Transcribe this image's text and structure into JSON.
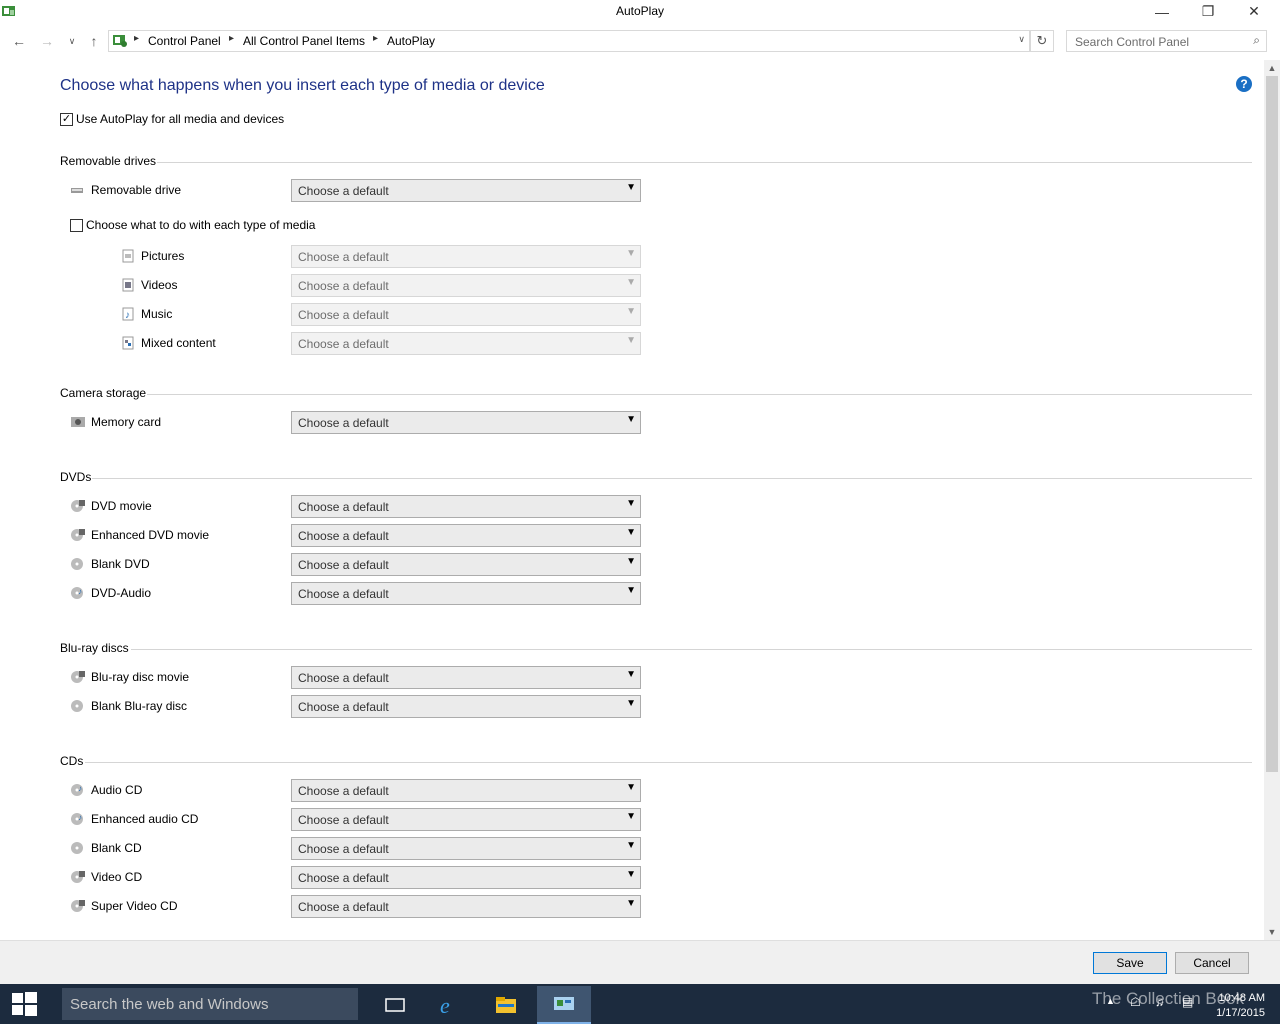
{
  "window": {
    "title": "AutoPlay"
  },
  "breadcrumb": [
    "Control Panel",
    "All Control Panel Items",
    "AutoPlay"
  ],
  "search": {
    "placeholder": "Search Control Panel"
  },
  "main": {
    "heading": "Choose what happens when you insert each type of media or device",
    "use_autoplay": {
      "label": "Use AutoPlay for all media and devices",
      "checked": true
    },
    "media_choice": {
      "label": "Choose what to do with each type of media",
      "checked": false
    },
    "default_option": "Choose a default",
    "sections": {
      "removable": {
        "title": "Removable drives",
        "items": [
          "Removable drive"
        ]
      },
      "media": {
        "items": [
          "Pictures",
          "Videos",
          "Music",
          "Mixed content"
        ]
      },
      "camera": {
        "title": "Camera storage",
        "items": [
          "Memory card"
        ]
      },
      "dvds": {
        "title": "DVDs",
        "items": [
          "DVD movie",
          "Enhanced DVD movie",
          "Blank DVD",
          "DVD-Audio"
        ]
      },
      "bluray": {
        "title": "Blu-ray discs",
        "items": [
          "Blu-ray disc movie",
          "Blank Blu-ray disc"
        ]
      },
      "cds": {
        "title": "CDs",
        "items": [
          "Audio CD",
          "Enhanced audio CD",
          "Blank CD",
          "Video CD",
          "Super Video CD"
        ]
      }
    }
  },
  "footer": {
    "save": "Save",
    "cancel": "Cancel"
  },
  "taskbar": {
    "search_placeholder": "Search the web and Windows",
    "time": "10:48 AM",
    "date": "1/17/2015",
    "watermark": "The Collection Book"
  },
  "colors": {
    "heading": "#1e3287",
    "taskbar": "#1c2b3e",
    "accent": "#0078d7"
  }
}
